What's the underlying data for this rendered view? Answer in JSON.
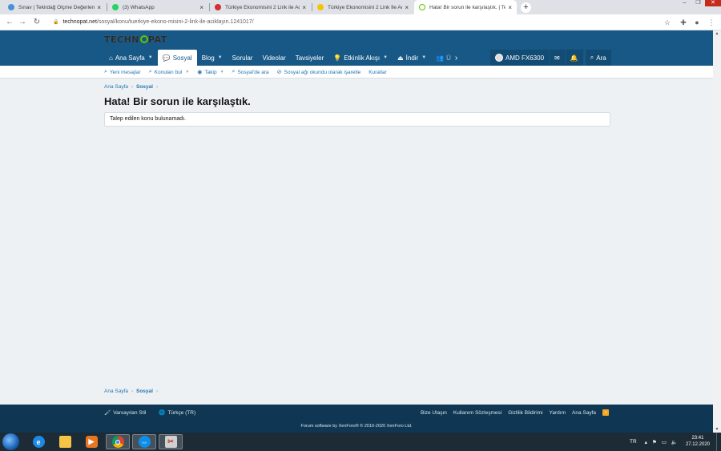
{
  "browser": {
    "tabs": [
      {
        "title": "Sınav | Tekirdağ Ölçme Değerlendirme",
        "favicon_color": "#4a90d9",
        "active": false
      },
      {
        "title": "(3) WhatsApp",
        "favicon_color": "#25d366",
        "active": false
      },
      {
        "title": "Türkiye Ekonomisini 2 Link ile Açıklayın",
        "favicon_color": "#d32f2f",
        "active": false
      },
      {
        "title": "Türkiye Ekonomisini 2 Link İle Açıklayın",
        "favicon_color": "#f5c400",
        "active": false
      },
      {
        "title": "Hata! Bir sorun ile karşılaştık. | Technopat",
        "favicon_color": "#61c400",
        "active": true
      }
    ],
    "close_glyph": "×",
    "new_tab_glyph": "+",
    "address": {
      "domain": "technopat.net",
      "path": "/sosyal/konu/tuerkiye-ekono-misini-2-link-ile-aciklayin.1241017/"
    },
    "icons": [
      "back-icon",
      "forward-icon",
      "reload-icon",
      "lock-icon",
      "star-icon",
      "extensions-icon",
      "profile-icon",
      "menu-icon"
    ]
  },
  "site": {
    "logo_parts": {
      "before": "TECHN",
      "after": "PAT"
    },
    "nav": [
      {
        "label": "Ana Sayfa",
        "icon": "home-icon",
        "dropdown": true,
        "selected": false
      },
      {
        "label": "Sosyal",
        "icon": "chat-icon",
        "dropdown": false,
        "selected": true
      },
      {
        "label": "Blog",
        "icon": "",
        "dropdown": true,
        "selected": false
      },
      {
        "label": "Sorular",
        "icon": "",
        "dropdown": false,
        "selected": false
      },
      {
        "label": "Videolar",
        "icon": "",
        "dropdown": false,
        "selected": false
      },
      {
        "label": "Tavsiyeler",
        "icon": "",
        "dropdown": false,
        "selected": false
      },
      {
        "label": "Etkinlik Akışı",
        "icon": "bulb-icon",
        "dropdown": true,
        "selected": false
      },
      {
        "label": "İndir",
        "icon": "download-icon",
        "dropdown": true,
        "selected": false
      },
      {
        "label": "Ü",
        "icon": "users-icon",
        "dropdown": false,
        "selected": false
      }
    ],
    "account": {
      "username": "AMD FX6300",
      "search_label": "Ara"
    },
    "subnav": [
      {
        "label": "Yeni mesajlar",
        "icon": "search-icon",
        "dropdown": false
      },
      {
        "label": "Konuları bul",
        "icon": "search-icon",
        "dropdown": true
      },
      {
        "label": "Takip",
        "icon": "eye-icon",
        "dropdown": true
      },
      {
        "label": "Sosyal'de ara",
        "icon": "search-icon",
        "dropdown": false
      },
      {
        "label": "Sosyal ağı okundu olarak işaretle",
        "icon": "eye-slash-icon",
        "dropdown": false
      },
      {
        "label": "Kurallar",
        "icon": "",
        "dropdown": false
      }
    ],
    "breadcrumb": [
      {
        "label": "Ana Sayfa"
      },
      {
        "label": "Sosyal"
      }
    ],
    "page_title": "Hata! Bir sorun ile karşılaştık.",
    "error_message": "Talep edilen konu bulunamadı.",
    "footer": {
      "style_label": "Varsayılan Stil",
      "language_label": "Türkçe (TR)",
      "links": [
        "Bize Ulaşın",
        "Kullanım Sözleşmesi",
        "Gizlilik Bildirimi",
        "Yardım",
        "Ana Sayfa"
      ],
      "copyright": "Forum software by XenForo® © 2010-2020 XenForo Ltd."
    },
    "colors": {
      "header": "#185886",
      "footer": "#0f3652",
      "link": "#2577b1",
      "accent_green": "#61c400"
    }
  },
  "taskbar": {
    "language": "TR",
    "time": "23:41",
    "date": "27.12.2020",
    "apps": [
      "ie-icon",
      "file-explorer-icon",
      "media-player-icon",
      "chrome-icon",
      "teamviewer-icon",
      "snipping-icon"
    ]
  }
}
